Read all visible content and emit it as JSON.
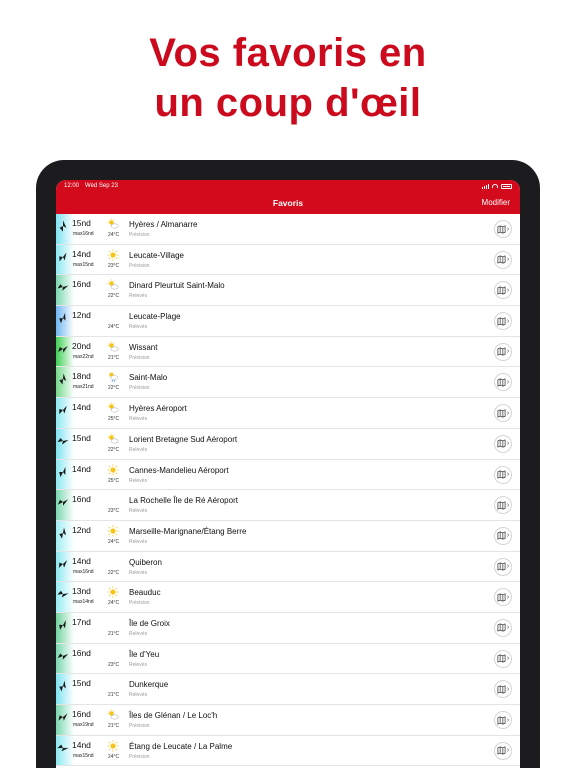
{
  "headline": {
    "line1": "Vos favoris en",
    "line2": "un coup d'œil"
  },
  "statusbar": {
    "time": "12:00",
    "date": "Wed Sep 23"
  },
  "navbar": {
    "title": "Favoris",
    "edit": "Modifier"
  },
  "colors": {
    "brand": "#d20a1c",
    "headline": "#cc0a1e"
  },
  "favorites": [
    {
      "speed": "15nd",
      "gust": "max16nd",
      "weather": "sun-cloud-icon",
      "temp": "24°C",
      "station": "Hyères / Almanarre",
      "kind": "Prévision",
      "strip": "#7ee3f1"
    },
    {
      "speed": "14nd",
      "gust": "max15nd",
      "weather": "sun-icon",
      "temp": "23°C",
      "station": "Leucate-Village",
      "kind": "Prévision",
      "strip": "#8be8f2"
    },
    {
      "speed": "16nd",
      "gust": "",
      "weather": "sun-cloud-icon",
      "temp": "22°C",
      "station": "Dinard Pleurtuit Saint-Malo",
      "kind": "Relevés",
      "strip": "#7ad7b0"
    },
    {
      "speed": "12nd",
      "gust": "",
      "weather": "",
      "temp": "24°C",
      "station": "Leucate-Plage",
      "kind": "Relevés",
      "strip": "#6fb6f0"
    },
    {
      "speed": "20nd",
      "gust": "max22nd",
      "weather": "sun-cloud-icon",
      "temp": "21°C",
      "station": "Wissant",
      "kind": "Prévision",
      "strip": "#3fcf54"
    },
    {
      "speed": "18nd",
      "gust": "max21nd",
      "weather": "sun-rain-icon",
      "temp": "22°C",
      "station": "Saint-Malo",
      "kind": "Prévision",
      "strip": "#74d889"
    },
    {
      "speed": "14nd",
      "gust": "",
      "weather": "sun-cloud-icon",
      "temp": "25°C",
      "station": "Hyères Aéroport",
      "kind": "Relevés",
      "strip": "#8be8f2"
    },
    {
      "speed": "15nd",
      "gust": "",
      "weather": "sun-cloud-icon",
      "temp": "22°C",
      "station": "Lorient Bretagne Sud Aéroport",
      "kind": "Relevés",
      "strip": "#7ee3f1"
    },
    {
      "speed": "14nd",
      "gust": "",
      "weather": "sun-icon",
      "temp": "25°C",
      "station": "Cannes-Mandelieu Aéroport",
      "kind": "Relevés",
      "strip": "#8be8f2"
    },
    {
      "speed": "16nd",
      "gust": "",
      "weather": "",
      "temp": "23°C",
      "station": "La Rochelle Île de Ré Aéroport",
      "kind": "Relevés",
      "strip": "#7ad7b0"
    },
    {
      "speed": "12nd",
      "gust": "",
      "weather": "sun-icon",
      "temp": "24°C",
      "station": "Marseille-Marignane/Étang Berre",
      "kind": "Relevés",
      "strip": "#a0eef5"
    },
    {
      "speed": "14nd",
      "gust": "max16nd",
      "weather": "",
      "temp": "22°C",
      "station": "Quiberon",
      "kind": "Relevés",
      "strip": "#8be8f2"
    },
    {
      "speed": "13nd",
      "gust": "max14nd",
      "weather": "sun-icon",
      "temp": "24°C",
      "station": "Beauduc",
      "kind": "Prévision",
      "strip": "#95ecf4"
    },
    {
      "speed": "17nd",
      "gust": "",
      "weather": "",
      "temp": "21°C",
      "station": "Île de Groix",
      "kind": "Relevés",
      "strip": "#72d39e"
    },
    {
      "speed": "16nd",
      "gust": "",
      "weather": "",
      "temp": "23°C",
      "station": "Île d'Yeu",
      "kind": "Relevés",
      "strip": "#7ad7b0"
    },
    {
      "speed": "15nd",
      "gust": "",
      "weather": "",
      "temp": "21°C",
      "station": "Dunkerque",
      "kind": "Relevés",
      "strip": "#7ee3f1"
    },
    {
      "speed": "16nd",
      "gust": "max19nd",
      "weather": "sun-cloud-icon",
      "temp": "21°C",
      "station": "Îles de Glénan / Le Loc'h",
      "kind": "Prévision",
      "strip": "#7ad7b0"
    },
    {
      "speed": "14nd",
      "gust": "max15nd",
      "weather": "sun-icon",
      "temp": "24°C",
      "station": "Étang de Leucate / La Palme",
      "kind": "Prévision",
      "strip": "#8be8f2"
    }
  ]
}
